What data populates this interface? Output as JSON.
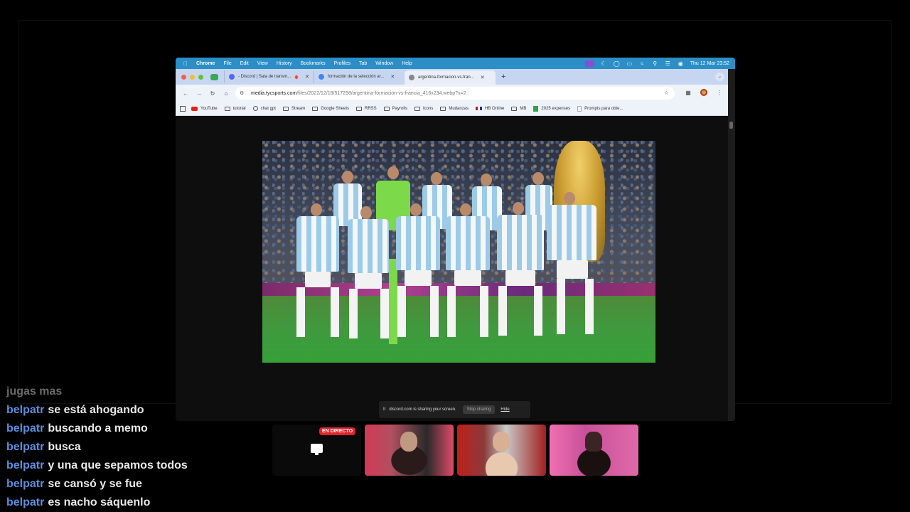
{
  "menubar": {
    "app": "Chrome",
    "items": [
      "File",
      "Edit",
      "View",
      "History",
      "Bookmarks",
      "Profiles",
      "Tab",
      "Window",
      "Help"
    ],
    "clock": "Thu 12 Mar  23:52"
  },
  "tabs": [
    {
      "label": "- Discord | Sala de transm...",
      "favicon_color": "#5865f2",
      "recording": true
    },
    {
      "label": "formación de la selección ar...",
      "favicon_color": "#4285f4",
      "recording": false
    },
    {
      "label": "argentina-formacion-vs-fran...",
      "favicon_color": "#888888",
      "recording": false,
      "active": true
    }
  ],
  "address": {
    "host": "media.tycsports.com",
    "path": "/files/2022/12/18/517258/argentina-formacion-vs-francia_416x234.webp?v=2"
  },
  "bookmarks": [
    {
      "label": "YouTube",
      "icon": "youtube-icon"
    },
    {
      "label": "tutorial",
      "icon": "folder-icon"
    },
    {
      "label": "chat gpt",
      "icon": "chatgpt-icon"
    },
    {
      "label": "Stream",
      "icon": "folder-icon"
    },
    {
      "label": "Google Sheets",
      "icon": "folder-icon"
    },
    {
      "label": "RRSS",
      "icon": "folder-icon"
    },
    {
      "label": "Payrolls",
      "icon": "folder-icon"
    },
    {
      "label": "Icons",
      "icon": "folder-icon"
    },
    {
      "label": "Mudanzas",
      "icon": "folder-icon"
    },
    {
      "label": "HB Online",
      "icon": "hb-icon"
    },
    {
      "label": "MB",
      "icon": "folder-icon"
    },
    {
      "label": "2025 expenses",
      "icon": "sheets-icon"
    },
    {
      "label": "Prompts para obte...",
      "icon": "doc-icon"
    }
  ],
  "share_bar": {
    "message": "discord.com is sharing your screen.",
    "stop_label": "Stop sharing",
    "hide_label": "Hide"
  },
  "live_badge": "EN DIRECTO",
  "chat": [
    {
      "user": "",
      "message": "jugas mas",
      "faded": true
    },
    {
      "user": "belpatr",
      "message": "se está ahogando"
    },
    {
      "user": "belpatr",
      "message": "buscando a memo"
    },
    {
      "user": "belpatr",
      "message": "busca"
    },
    {
      "user": "belpatr",
      "message": "y una que sepamos todos"
    },
    {
      "user": "belpatr",
      "message": "se cansó y se fue"
    },
    {
      "user": "belpatr",
      "message": "es nacho sáquenlo"
    }
  ],
  "colors": {
    "menubar": "#2b8ec7",
    "chat_user": "#5a8fe0",
    "live_badge": "#e0242c"
  }
}
